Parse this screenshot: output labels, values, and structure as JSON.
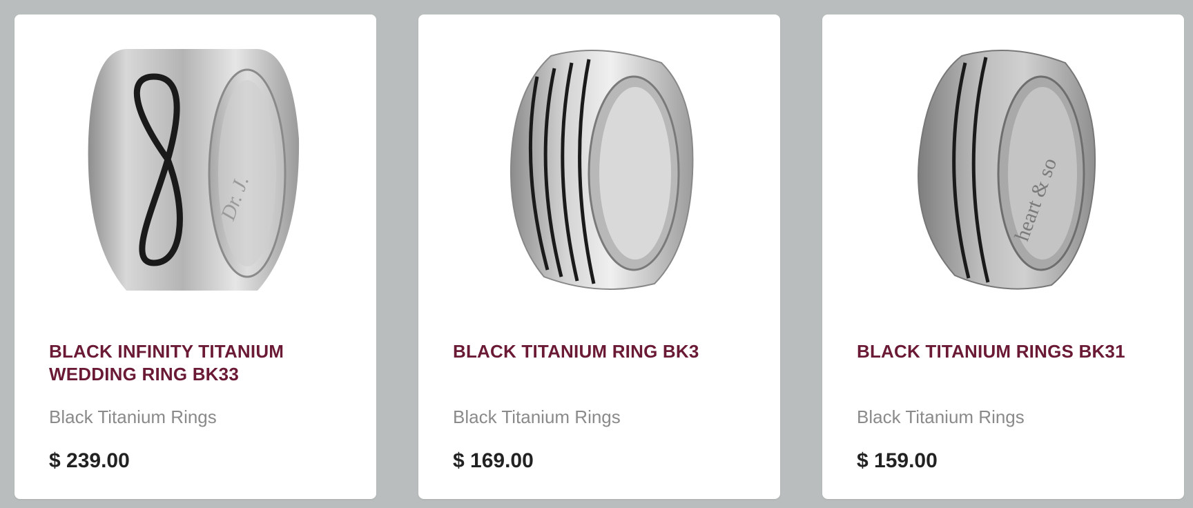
{
  "products": [
    {
      "title": "BLACK INFINITY TITANIUM WEDDING RING BK33",
      "category": "Black Titanium Rings",
      "price": "$ 239.00",
      "image_icon": "infinity-titanium-ring-image",
      "engraving": "Dr. J."
    },
    {
      "title": "BLACK TITANIUM RING BK3",
      "category": "Black Titanium Rings",
      "price": "$ 169.00",
      "image_icon": "striped-titanium-ring-image"
    },
    {
      "title": "BLACK TITANIUM RINGS BK31",
      "category": "Black Titanium Rings",
      "price": "$ 159.00",
      "image_icon": "dome-titanium-ring-image",
      "engraving": "heart & so"
    }
  ],
  "colors": {
    "page_background": "#b9bdbd",
    "card_background": "#ffffff",
    "title": "#6b1a35",
    "category": "#8a8a8a",
    "price": "#222222",
    "metal": "#c9c9c9",
    "inlay": "#1a1a1a"
  }
}
